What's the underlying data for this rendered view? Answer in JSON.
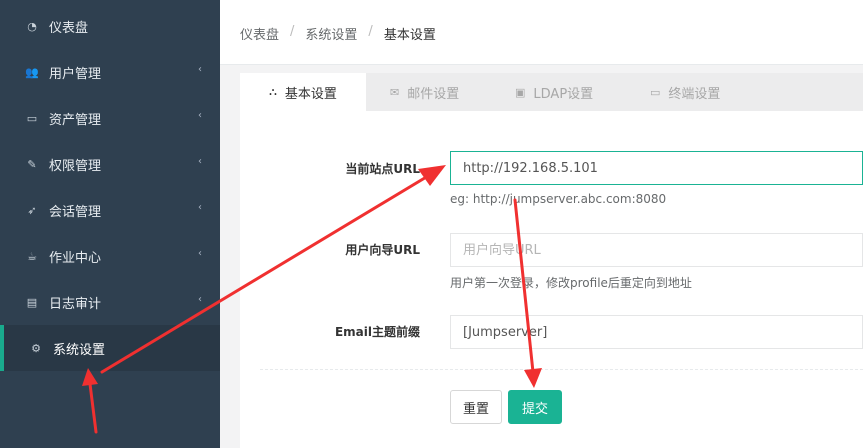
{
  "sidebar": {
    "items": [
      {
        "label": "仪表盘",
        "icon": "dashboard-icon",
        "glyph": "◔",
        "chevron": ""
      },
      {
        "label": "用户管理",
        "icon": "users-icon",
        "glyph": "👥",
        "chevron": "‹"
      },
      {
        "label": "资产管理",
        "icon": "inbox-icon",
        "glyph": "▭",
        "chevron": "‹"
      },
      {
        "label": "权限管理",
        "icon": "edit-icon",
        "glyph": "✎",
        "chevron": "‹"
      },
      {
        "label": "会话管理",
        "icon": "rocket-icon",
        "glyph": "➶",
        "chevron": "‹"
      },
      {
        "label": "作业中心",
        "icon": "coffee-icon",
        "glyph": "☕",
        "chevron": "‹"
      },
      {
        "label": "日志审计",
        "icon": "calendar-icon",
        "glyph": "▤",
        "chevron": "‹"
      },
      {
        "label": "系统设置",
        "icon": "gears-icon",
        "glyph": "⚙",
        "chevron": ""
      }
    ]
  },
  "breadcrumb": {
    "items": [
      "仪表盘",
      "系统设置",
      "基本设置"
    ],
    "separator": "/"
  },
  "tabs": [
    {
      "label": "基本设置",
      "icon": "cubes-icon",
      "glyph": "⛬"
    },
    {
      "label": "邮件设置",
      "icon": "envelope-icon",
      "glyph": "✉"
    },
    {
      "label": "LDAP设置",
      "icon": "archive-icon",
      "glyph": "▣"
    },
    {
      "label": "终端设置",
      "icon": "hdd-icon",
      "glyph": "▭"
    }
  ],
  "form": {
    "site_url": {
      "label": "当前站点URL",
      "value": "http://192.168.5.101",
      "help": "eg: http://jumpserver.abc.com:8080"
    },
    "user_guide_url": {
      "label": "用户向导URL",
      "placeholder": "用户向导URL",
      "help": "用户第一次登录，修改profile后重定向到地址"
    },
    "email_subject_prefix": {
      "label": "Email主题前缀",
      "value": "[Jumpserver]"
    }
  },
  "buttons": {
    "reset": "重置",
    "submit": "提交"
  },
  "colors": {
    "sidebar": "#2f4050",
    "accent": "#1ab394",
    "arrow": "#f03030"
  }
}
